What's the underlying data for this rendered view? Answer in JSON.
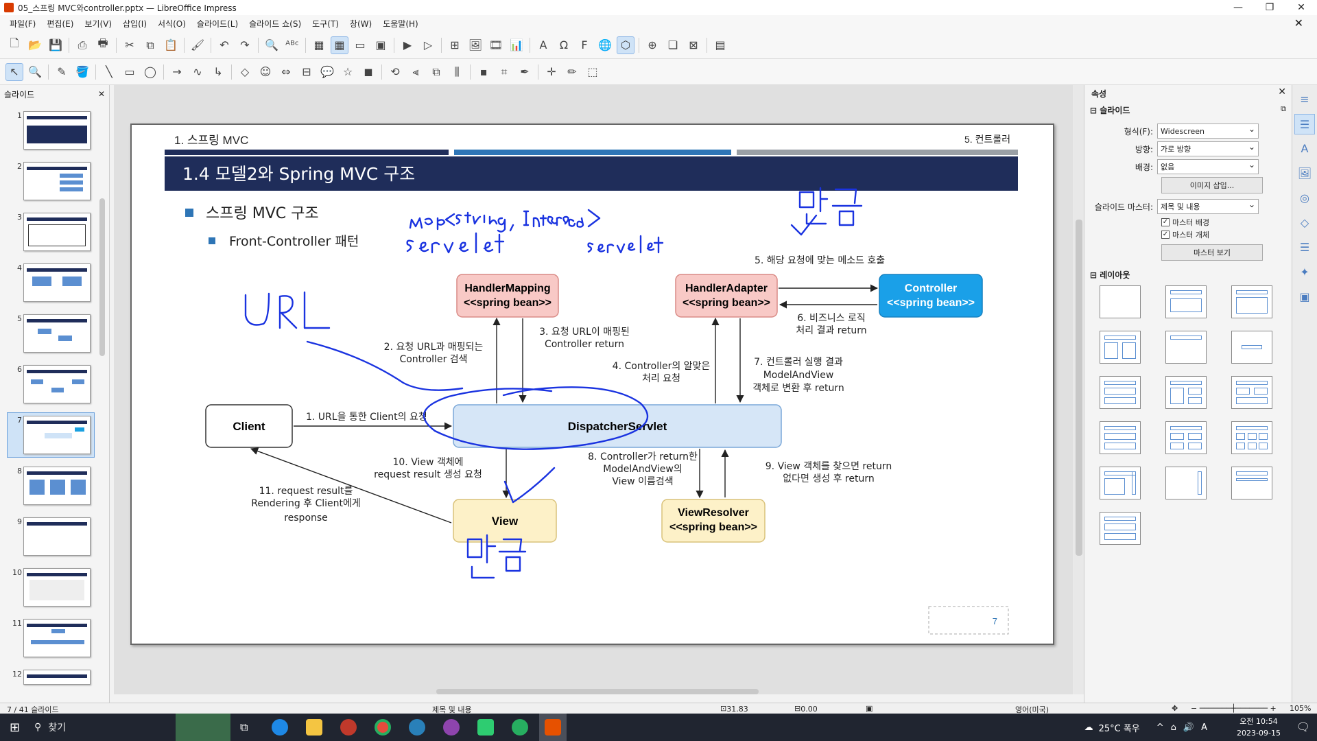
{
  "window": {
    "title": "05_스프링 MVC와controller.pptx — LibreOffice Impress"
  },
  "menu": [
    "파일(F)",
    "편집(E)",
    "보기(V)",
    "삽입(I)",
    "서식(O)",
    "슬라이드(L)",
    "슬라이드 쇼(S)",
    "도구(T)",
    "창(W)",
    "도움말(H)"
  ],
  "slides_panel": {
    "title": "슬라이드",
    "numbers": [
      "1",
      "2",
      "3",
      "4",
      "5",
      "6",
      "7",
      "8",
      "9",
      "10",
      "11",
      "12"
    ],
    "selected": "7"
  },
  "slide": {
    "header_left": "1. 스프링 MVC",
    "header_right": "5. 컨트롤러",
    "title": "1.4  모델2와 Spring  MVC  구조",
    "bullet1": "스프링 MVC  구조",
    "bullet2": "Front-Controller  패턴",
    "page_number": "7",
    "boxes": {
      "client": "Client",
      "dispatcher": "DispatcherServlet",
      "hm1": "HandlerMapping",
      "hm2": "<<spring bean>>",
      "ha1": "HandlerAdapter",
      "ha2": "<<spring bean>>",
      "ctrl1": "Controller",
      "ctrl2": "<<spring bean>>",
      "view": "View",
      "vr1": "ViewResolver",
      "vr2": "<<spring bean>>"
    },
    "labels": {
      "l1": "1. URL을 통한 Client의 요청",
      "l2a": "2. 요청 URL과 매핑되는",
      "l2b": "Controller 검색",
      "l3a": "3. 요청 URL이 매핑된",
      "l3b": "Controller return",
      "l4a": "4. Controller의 알맞은",
      "l4b": "처리 요청",
      "l5": "5. 해당 요청에 맞는 메소드 호출",
      "l6a": "6. 비즈니스 로직",
      "l6b": "처리 결과 return",
      "l7a": "7. 컨트롤러 실행 결과",
      "l7b": "ModelAndView",
      "l7c": "객체로 변환 후 return",
      "l8a": "8. Controller가 return한",
      "l8b": "ModelAndView의",
      "l8c": "View 이름검색",
      "l9a": "9. View 객체를 찾으면 return",
      "l9b": "없다면 생성 후 return",
      "l10a": "10. View 객체에",
      "l10b": "request result 생성 요청",
      "l11a": "11. request result를",
      "l11b": "Rendering 후 Client에게",
      "l11c": "response"
    }
  },
  "properties": {
    "title": "속성",
    "section_slide": "슬라이드",
    "format_label": "형식(F):",
    "format_value": "Widescreen",
    "orient_label": "방향:",
    "orient_value": "가로 방향",
    "bg_label": "배경:",
    "bg_value": "없음",
    "insert_image": "이미지 삽입...",
    "master_label": "슬라이드 마스터:",
    "master_value": "제목 및 내용",
    "chk_bg": "마스터 배경",
    "chk_obj": "마스터 개체",
    "master_view": "마스터 보기",
    "section_layout": "레이아웃"
  },
  "status": {
    "slide_count": "7 / 41 슬라이드",
    "layout": "제목 및 내용",
    "position": "31.83 / 6.70",
    "size": "0.00 x 0.00",
    "language": "영어(미국)",
    "zoom": "105%"
  },
  "taskbar": {
    "search": "찾기",
    "weather": "25°C  폭우",
    "time": "오전 10:54",
    "date": "2023-09-15"
  }
}
